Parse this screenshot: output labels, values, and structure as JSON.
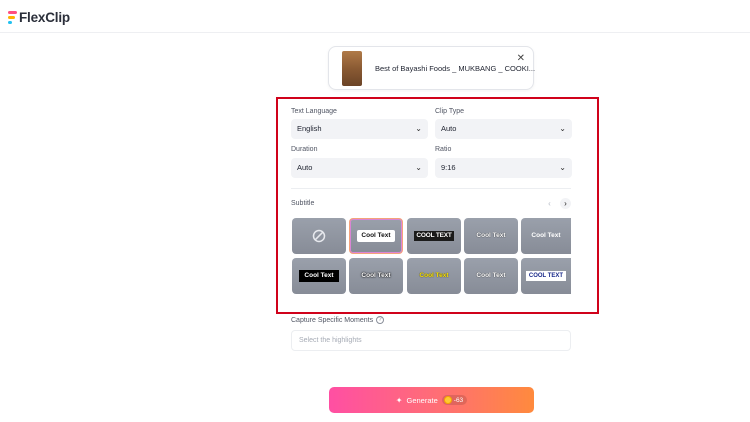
{
  "brand": {
    "name": "FlexClip",
    "colors": [
      "#ff4f81",
      "#ffb100",
      "#22c1f0"
    ]
  },
  "video": {
    "title": "Best of Bayashi Foods _ MUKBANG _ COOKI...",
    "close_icon": "close-icon"
  },
  "form": {
    "text_language": {
      "label": "Text Language",
      "value": "English"
    },
    "clip_type": {
      "label": "Clip Type",
      "value": "Auto"
    },
    "duration": {
      "label": "Duration",
      "value": "Auto"
    },
    "ratio": {
      "label": "Ratio",
      "value": "9:16"
    }
  },
  "subtitle": {
    "label": "Subtitle",
    "prev_icon": "chevron-left-icon",
    "next_icon": "chevron-right-icon",
    "styles": [
      {
        "text": "",
        "icon": "none-icon",
        "selected": false
      },
      {
        "text": "Cool Text",
        "selected": true
      },
      {
        "text": "COOL TEXT",
        "selected": false
      },
      {
        "text": "Cool Text",
        "selected": false
      },
      {
        "text": "Cool Text",
        "selected": false
      },
      {
        "text": "Cool Text",
        "selected": false
      },
      {
        "text": "Cool Text",
        "selected": false
      },
      {
        "text": "Cool Text",
        "selected": false
      },
      {
        "text": "Cool Text",
        "selected": false
      },
      {
        "text": "COOL TEXT",
        "selected": false
      }
    ]
  },
  "moments": {
    "label": "Capture Specific Moments",
    "placeholder": "Select the highlights"
  },
  "generate": {
    "label": "Generate",
    "credits": "-63"
  },
  "highlight_color": "#d0021b"
}
